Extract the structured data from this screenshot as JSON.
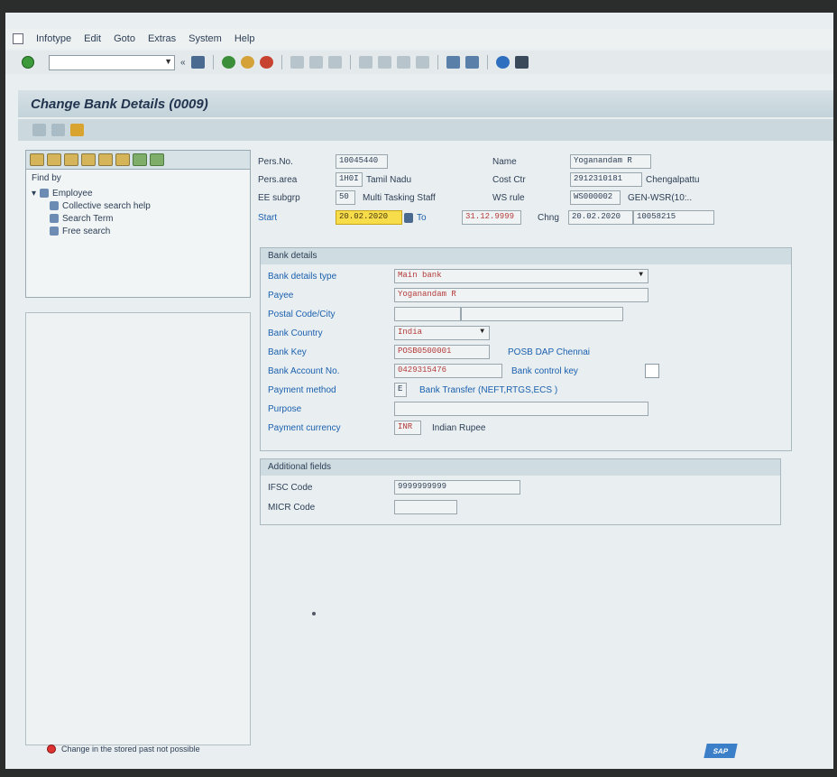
{
  "menu": {
    "items": [
      "Infotype",
      "Edit",
      "Goto",
      "Extras",
      "System",
      "Help"
    ]
  },
  "toolbar": {
    "command_value": ""
  },
  "title": "Change Bank Details (0009)",
  "left_panel": {
    "find_by": "Find by",
    "tree": [
      "Employee",
      "Collective search help",
      "Search Term",
      "Free search"
    ]
  },
  "header": {
    "persno_label": "Pers.No.",
    "persno_value": "10045440",
    "name_label": "Name",
    "name_value": "Yoganandam R",
    "persarea_label": "Pers.area",
    "persarea_code": "1H0I",
    "persarea_text": "Tamil Nadu",
    "costctr_label": "Cost Ctr",
    "costctr_value": "2912310181",
    "costctr_text": "Chengalpattu",
    "eesubgrp_label": "EE subgrp",
    "eesubgrp_code": "50",
    "eesubgrp_text": "Multi Tasking Staff",
    "wsrule_label": "WS rule",
    "wsrule_value": "WS000002",
    "wsrule_text": "GEN-WSR(10:..",
    "start_label": "Start",
    "start_value": "20.02.2020",
    "to_label": "To",
    "to_value": "31.12.9999",
    "chng_label": "Chng",
    "chng_date": "20.02.2020",
    "chng_user": "10058215"
  },
  "bank_details": {
    "title": "Bank details",
    "type_label": "Bank details type",
    "type_value": "Main bank",
    "payee_label": "Payee",
    "payee_value": "Yoganandam R",
    "postal_label": "Postal Code/City",
    "postal_value": "",
    "city_value": "",
    "country_label": "Bank Country",
    "country_value": "India",
    "key_label": "Bank Key",
    "key_value": "POSB0500001",
    "key_text": "POSB DAP Chennai",
    "account_label": "Bank Account No.",
    "account_value": "0429315476",
    "control_label": "Bank control key",
    "method_label": "Payment method",
    "method_value": "E",
    "method_text": "Bank Transfer (NEFT,RTGS,ECS )",
    "purpose_label": "Purpose",
    "purpose_value": "",
    "currency_label": "Payment currency",
    "currency_value": "INR",
    "currency_text": "Indian Rupee"
  },
  "additional": {
    "title": "Additional fields",
    "ifsc_label": "IFSC Code",
    "ifsc_value": "9999999999",
    "micr_label": "MICR Code",
    "micr_value": ""
  },
  "status": {
    "message": "Change in the stored past not possible"
  },
  "logo": "SAP"
}
